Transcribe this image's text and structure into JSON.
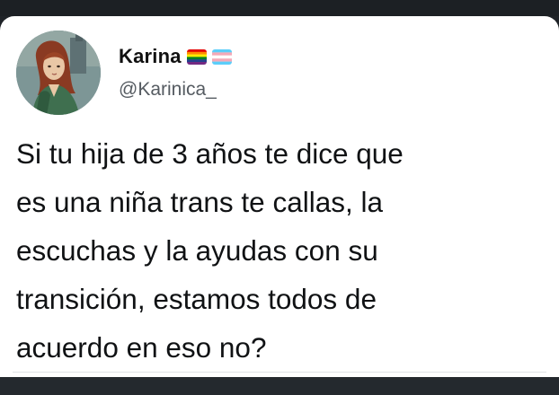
{
  "tweet": {
    "author": {
      "display_name": "Karina",
      "handle": "@Karinica_",
      "avatar_icon": "illustrated-portrait-avatar",
      "badges": [
        {
          "icon": "rainbow-flag-icon"
        },
        {
          "icon": "transgender-flag-icon"
        }
      ]
    },
    "text": "Si tu hija de 3 años te dice que\nes una niña trans te callas, la\nescuchas y la ayudas con su\ntransición, estamos todos de\nacuerdo en eso no?"
  },
  "colors": {
    "background": "#1f2328",
    "card": "#ffffff",
    "name_text": "#111111",
    "handle_text": "#555b61",
    "body_text": "#101214"
  }
}
